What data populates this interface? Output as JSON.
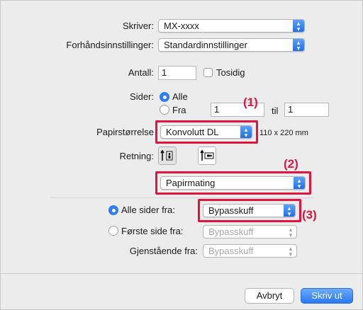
{
  "printer": {
    "label": "Skriver:",
    "value": "MX-xxxx"
  },
  "presets": {
    "label": "Forhåndsinnstillinger:",
    "value": "Standardinnstillinger"
  },
  "copies": {
    "label": "Antall:",
    "value": "1",
    "two_sided_label": "Tosidig"
  },
  "pages": {
    "label": "Sider:",
    "all_label": "Alle",
    "from_label": "Fra",
    "from_value": "1",
    "to_label": "til",
    "to_value": "1"
  },
  "paper_size": {
    "label": "Papirstørrelse",
    "value": "Konvolutt DL",
    "dimensions": "110 x 220 mm"
  },
  "orientation": {
    "label": "Retning:"
  },
  "section_menu": {
    "value": "Papirmating"
  },
  "feed": {
    "all_pages_label": "Alle sider fra:",
    "all_pages_value": "Bypasskuff",
    "first_page_label": "Første side fra:",
    "first_page_value": "Bypasskuff",
    "remaining_label": "Gjenstående fra:",
    "remaining_value": "Bypasskuff"
  },
  "annotations": {
    "a1": "(1)",
    "a2": "(2)",
    "a3": "(3)",
    "color": "#e0143c"
  },
  "buttons": {
    "cancel": "Avbryt",
    "print": "Skriv ut"
  },
  "colors": {
    "accent": "#2e7ef2",
    "dialog_bg": "#ececec"
  }
}
